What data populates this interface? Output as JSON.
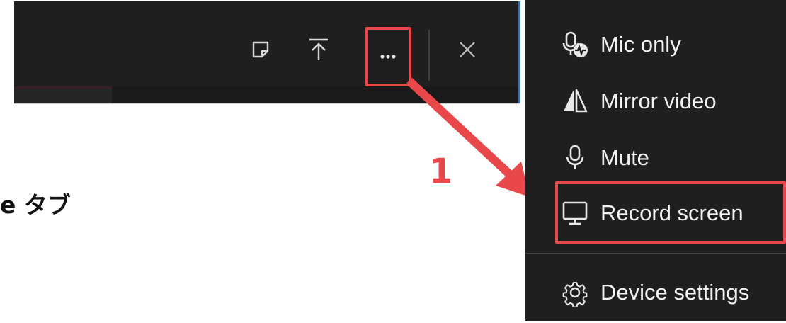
{
  "toolbar": {
    "icons": [
      "sticky-note-icon",
      "upload-icon",
      "more-options-icon",
      "close-icon"
    ]
  },
  "annotation": {
    "step_number": "1",
    "accent_color": "#e8484a"
  },
  "background_text": {
    "partial_label": "e タブ"
  },
  "menu": {
    "items": [
      {
        "label": "Mic only",
        "icon": "mic-only-icon"
      },
      {
        "label": "Mirror video",
        "icon": "mirror-icon"
      },
      {
        "label": "Mute",
        "icon": "mic-icon"
      },
      {
        "label": "Record screen",
        "icon": "monitor-icon"
      },
      {
        "label": "Device settings",
        "icon": "gear-icon"
      }
    ]
  }
}
